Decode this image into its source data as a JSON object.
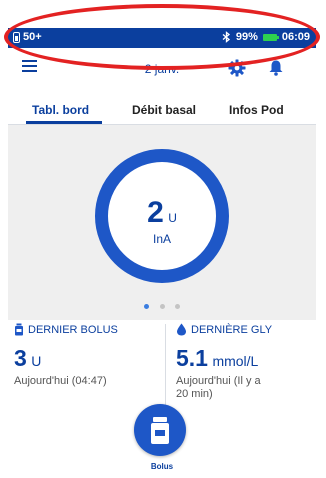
{
  "status_bar": {
    "carrier": "50+",
    "battery": "99%",
    "time": "06:09"
  },
  "header": {
    "date": "2 janv."
  },
  "tabs": [
    {
      "label": "Tabl. bord"
    },
    {
      "label": "Débit basal"
    },
    {
      "label": "Infos Pod"
    }
  ],
  "dashboard": {
    "value": "2",
    "unit": "U",
    "label": "InA",
    "page_dots": 3,
    "active_dot": 0
  },
  "last_bolus": {
    "heading": "DERNIER BOLUS",
    "value": "3",
    "unit": "U",
    "sub": "Aujourd'hui (04:47)"
  },
  "last_bg": {
    "heading": "DERNIÈRE GLY",
    "value": "5.1",
    "unit": "mmol/L",
    "sub_line1": "Aujourd'hui (Il y a",
    "sub_line2": "20 min)"
  },
  "bolus_button": {
    "label": "Bolus"
  },
  "colors": {
    "primary": "#0b3f9e",
    "accent": "#1e57c7",
    "highlight": "#e32222",
    "battery": "#2ed04f"
  }
}
